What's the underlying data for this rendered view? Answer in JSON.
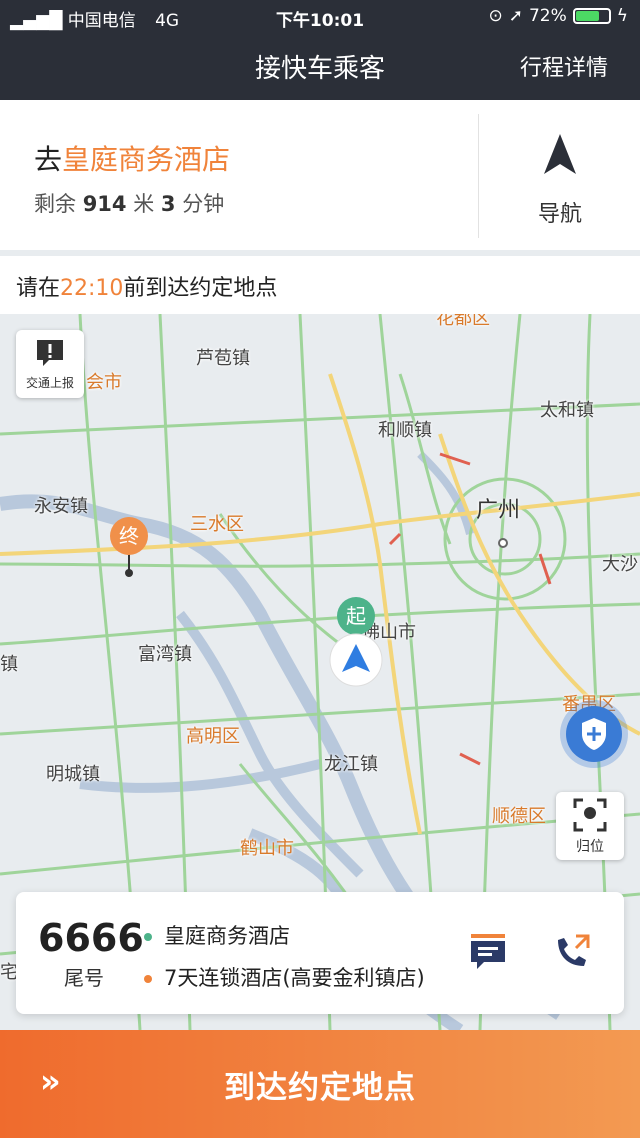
{
  "status_bar": {
    "carrier": "中国电信",
    "network": "4G",
    "time": "下午10:01",
    "battery_percent": "72%",
    "battery_level": 0.72
  },
  "header": {
    "title": "接快车乘客",
    "detail_link": "行程详情"
  },
  "destination": {
    "prefix": "去",
    "name": "皇庭商务酒店",
    "remain_label": "剩余",
    "distance": "914",
    "distance_unit": "米",
    "minutes": "3",
    "minutes_unit": "分钟",
    "nav_label": "导航"
  },
  "eta": {
    "before": "请在",
    "time": "22:10",
    "after": "前到达约定地点"
  },
  "map": {
    "traffic_report_label": "交通上报",
    "locate_label": "归位",
    "end_marker": "终",
    "start_marker": "起",
    "places": {
      "huadu": "花都区",
      "lubao": "芦苞镇",
      "sihui": "会市",
      "taihe": "太和镇",
      "heshun": "和顺镇",
      "yongan": "永安镇",
      "sanshui": "三水区",
      "guangzhou": "广州",
      "dashi": "大沙",
      "foshan": "佛山市",
      "fuwan": "富湾镇",
      "zhen_left": "镇",
      "panyu": "番禺区",
      "gaoming": "高明区",
      "mingcheng": "明城镇",
      "longjiang": "龙江镇",
      "shunde": "顺德区",
      "heshan": "鹤山市",
      "zhai": "宅"
    },
    "colors": {
      "road": "#9fd49a",
      "major_road": "#f3d57a",
      "river": "#b8c8dc",
      "congestion": "#e06050"
    }
  },
  "passenger": {
    "tail_number": "6666",
    "tail_label": "尾号",
    "pickup": "皇庭商务酒店",
    "dropoff": "7天连锁酒店(高要金利镇店)",
    "pickup_color": "#4db38a",
    "dropoff_color": "#f0833a"
  },
  "action": {
    "arrive_label": "到达约定地点",
    "chevron": "»"
  }
}
